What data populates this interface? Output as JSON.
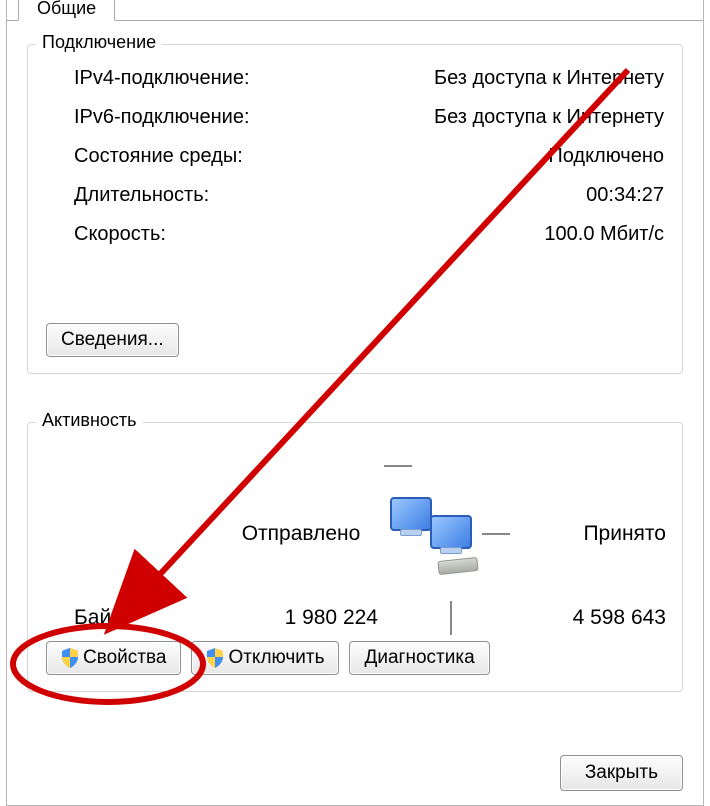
{
  "tab": {
    "label": "Общие"
  },
  "connection": {
    "title": "Подключение",
    "rows": {
      "ipv4_label": "IPv4-подключение:",
      "ipv4_value": "Без доступа к Интернету",
      "ipv6_label": "IPv6-подключение:",
      "ipv6_value": "Без доступа к Интернету",
      "media_label": "Состояние среды:",
      "media_value": "Подключено",
      "duration_label": "Длительность:",
      "duration_value": "00:34:27",
      "speed_label": "Скорость:",
      "speed_value": "100.0 Мбит/с"
    },
    "details_button": "Сведения..."
  },
  "activity": {
    "title": "Активность",
    "sent_label": "Отправлено",
    "received_label": "Принято",
    "bytes_label": "Байт:",
    "bytes_sent": "1 980 224",
    "bytes_received": "4 598 643",
    "properties_button": "Свойства",
    "disable_button": "Отключить",
    "diagnose_button": "Диагностика"
  },
  "footer": {
    "close_button": "Закрыть"
  }
}
